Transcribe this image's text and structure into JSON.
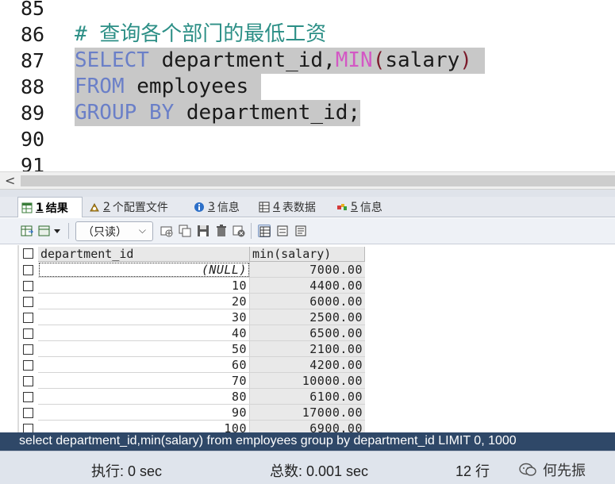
{
  "editor": {
    "line_numbers": [
      "85",
      "86",
      "87",
      "88",
      "89",
      "90",
      "91"
    ],
    "comment": "# 查询各个部门的最低工资",
    "line87": {
      "kw1": "SELECT",
      "t1": " department_id,",
      "fn": "MIN",
      "p1": "(",
      "t2": "salary",
      "p2": ")"
    },
    "line88": {
      "kw": "FROM",
      "t": " employees"
    },
    "line89": {
      "kw1": "GROUP",
      "sp": " ",
      "kw2": "BY",
      "t": " department_id;"
    },
    "hscroll_left": "<"
  },
  "tabs": [
    {
      "num": "1",
      "label": "结果",
      "icon": "table-result-icon",
      "active": true
    },
    {
      "num": "2",
      "label": "个配置文件",
      "icon": "profile-icon",
      "active": false
    },
    {
      "num": "3",
      "label": "信息",
      "icon": "info-icon",
      "active": false
    },
    {
      "num": "4",
      "label": "表数据",
      "icon": "table-data-icon",
      "active": false
    },
    {
      "num": "5",
      "label": "信息",
      "icon": "info-color-icon",
      "active": false
    }
  ],
  "toolbar": {
    "readonly_select": "（只读）",
    "chevron": "⌵"
  },
  "grid": {
    "columns": [
      "department_id",
      "min(salary)"
    ],
    "rows": [
      {
        "dept": "(NULL)",
        "min": "7000.00"
      },
      {
        "dept": "10",
        "min": "4400.00"
      },
      {
        "dept": "20",
        "min": "6000.00"
      },
      {
        "dept": "30",
        "min": "2500.00"
      },
      {
        "dept": "40",
        "min": "6500.00"
      },
      {
        "dept": "50",
        "min": "2100.00"
      },
      {
        "dept": "60",
        "min": "4200.00"
      },
      {
        "dept": "70",
        "min": "10000.00"
      },
      {
        "dept": "80",
        "min": "6100.00"
      },
      {
        "dept": "90",
        "min": "17000.00"
      },
      {
        "dept": "100",
        "min": "6900.00"
      }
    ]
  },
  "status": {
    "query": "select department_id,min(salary) from employees group by department_id LIMIT 0, 1000",
    "exec_time": "执行: 0 sec",
    "total_time": "总数: 0.001 sec",
    "rows": "12 行",
    "watermark": "何先振"
  },
  "colors": {
    "keyword": "#6a7fc8",
    "function": "#d357c4",
    "comment": "#2c8f86",
    "selection": "#c8c8c8",
    "query_bar": "#2f4868"
  }
}
